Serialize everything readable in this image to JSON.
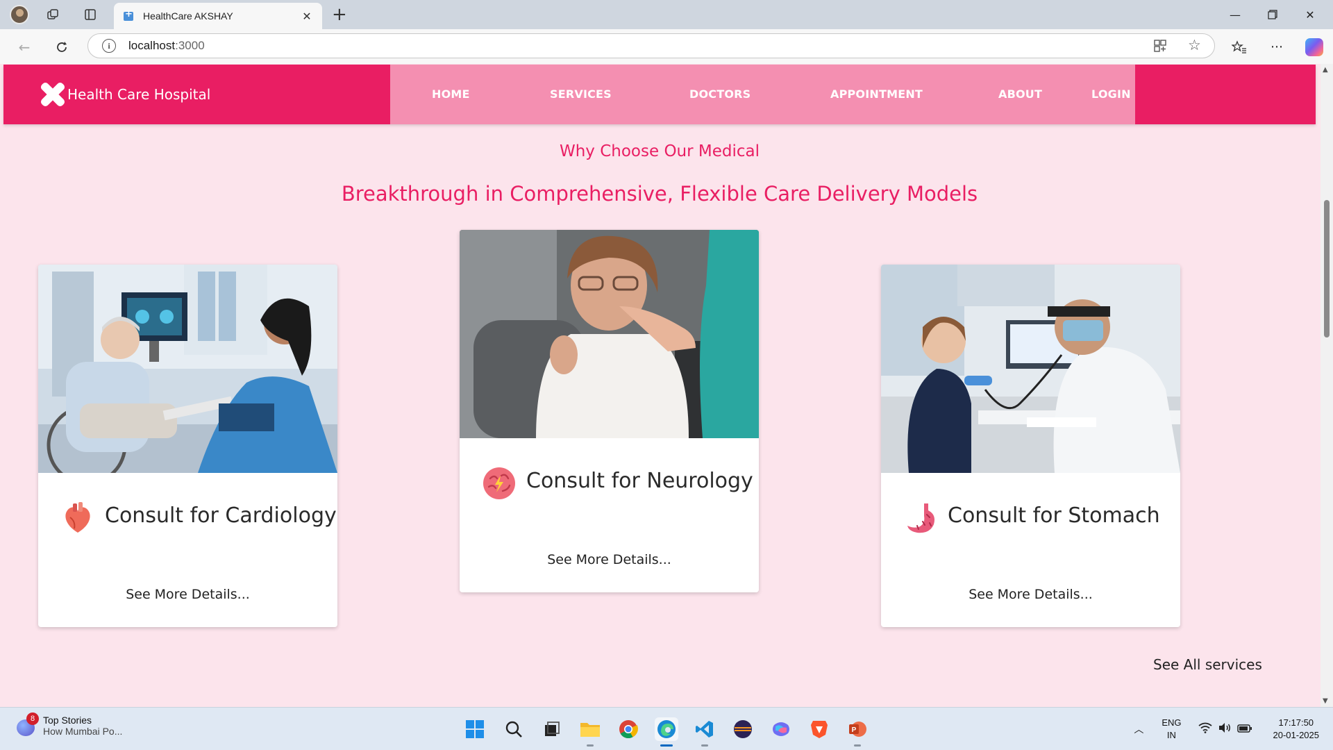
{
  "browser": {
    "tab_title": "HealthCare AKSHAY",
    "url_host": "localhost",
    "url_port": ":3000"
  },
  "site": {
    "brand": "Health Care Hospital",
    "nav": [
      "HOME",
      "SERVICES",
      "DOCTORS",
      "APPOINTMENT",
      "ABOUT",
      "LOGIN"
    ],
    "colors": {
      "primary": "#e91e63",
      "nav_bg": "#f48fb1",
      "page_bg": "#fce4ec"
    }
  },
  "section": {
    "subtitle": "Why Choose Our Medical",
    "title": "Breakthrough in Comprehensive, Flexible Care Delivery Models",
    "cards": [
      {
        "title": "Consult for Cardiology",
        "icon": "heart-icon",
        "link": "See More Details..."
      },
      {
        "title": "Consult for Neurology",
        "icon": "brain-icon",
        "link": "See More Details..."
      },
      {
        "title": "Consult for Stomach",
        "icon": "stomach-icon",
        "link": "See More Details..."
      }
    ],
    "see_all": "See All services"
  },
  "taskbar": {
    "news_badge": "8",
    "news_title": "Top Stories",
    "news_text": "How Mumbai Po...",
    "lang": "ENG",
    "region": "IN",
    "time": "17:17:50",
    "date": "20-01-2025"
  }
}
